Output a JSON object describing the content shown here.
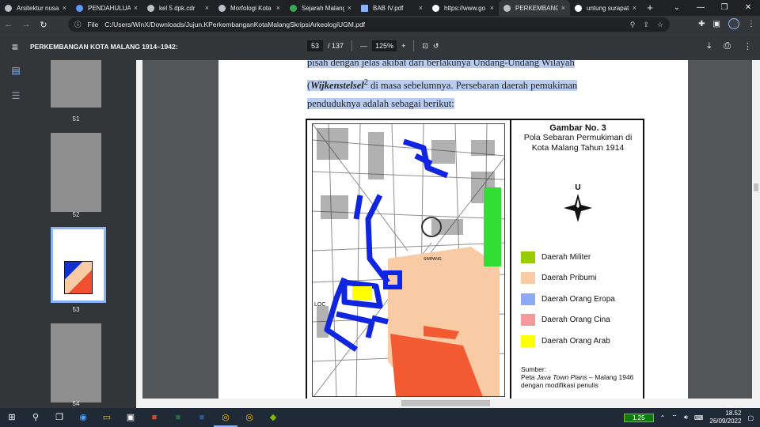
{
  "browser": {
    "tabs": [
      {
        "title": "Arsitektur nusa"
      },
      {
        "title": "PENDAHULUAN"
      },
      {
        "title": "kel 5 dpk.cdr"
      },
      {
        "title": "Morfologi Kota"
      },
      {
        "title": "Sejarah Malang"
      },
      {
        "title": "BAB IV.pdf"
      },
      {
        "title": "https://www.go"
      },
      {
        "title": "PERKEMBANG"
      },
      {
        "title": "untung surapat"
      }
    ],
    "new_tab": "+",
    "address": {
      "chip": "File",
      "url": "C:/Users/WinX/Downloads/Jujun.KPerkembanganKotaMalangSkripsiArkeologiUGM.pdf"
    }
  },
  "pdf": {
    "title": "PERKEMBANGAN KOTA MALANG 1914–1942:",
    "page_current": "53",
    "page_total": "/ 137",
    "zoom": "125%",
    "zoom_out": "—",
    "zoom_in": "+"
  },
  "thumbnails": [
    {
      "label": "51"
    },
    {
      "label": "52"
    },
    {
      "label": "53"
    },
    {
      "label": "54"
    }
  ],
  "content": {
    "line1": "pisah dengan jelas akibat dari berlakunya Undang-Undang Wilayah",
    "line2_pre": "(",
    "line2_em": "Wijkenstelsel",
    "line2_sup": "2",
    "line2_post": " di masa sebelumnya. Persebaran daerah pemukiman",
    "line3": "penduduknya adalah sebagai berikut:"
  },
  "figure": {
    "title": "Gambar No. 3",
    "subtitle1": "Pola Sebaran Permukiman di",
    "subtitle2": "Kota Malang Tahun 1914",
    "north": "U",
    "legend": [
      {
        "label": "Daerah Militer",
        "color": "#99cc00"
      },
      {
        "label": "Daerah Pribumi",
        "color": "#f8cba4"
      },
      {
        "label": "Daerah Orang Eropa",
        "color": "#8eaaf5"
      },
      {
        "label": "Daerah Orang Cina",
        "color": "#f59a9a"
      },
      {
        "label": "Daerah Orang Arab",
        "color": "#ffff00"
      }
    ],
    "source_label": "Sumber:",
    "source_pre": "Peta ",
    "source_em": "Java Town Plans",
    "source_post": " – Malang 1946",
    "source_line3": "dengan modifikasi penulis",
    "map_labels": [
      "LOC",
      "SIMPANG"
    ]
  },
  "taskbar": {
    "battery": "1.25",
    "time": "18.52",
    "date": "26/09/2022"
  }
}
